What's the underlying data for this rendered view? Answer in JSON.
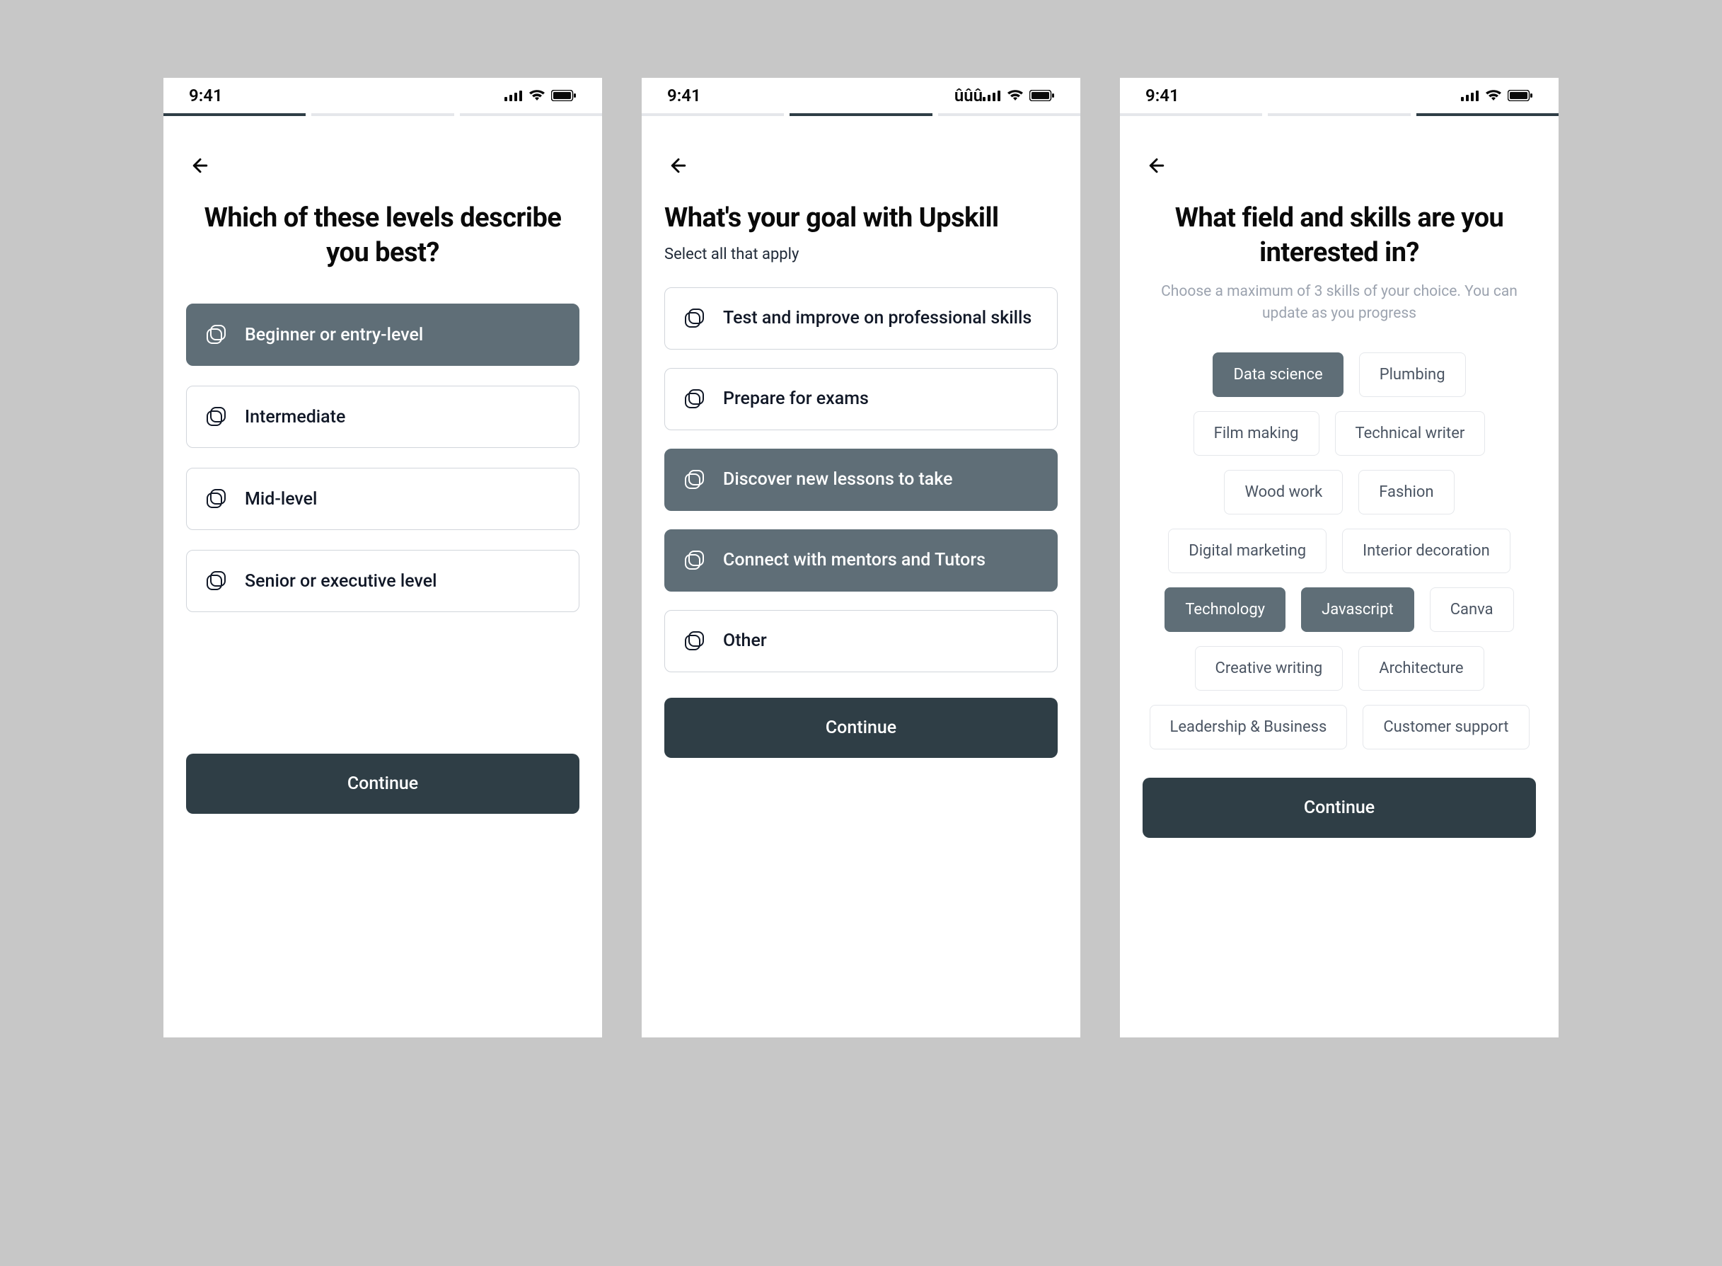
{
  "status": {
    "time": "9:41"
  },
  "colors": {
    "accent": "#5f6e77",
    "primary_button": "#2f3e46",
    "border": "#d1d5db",
    "bg": "#ffffff",
    "canvas": "#c7c7c7",
    "muted_text": "#9ca3af"
  },
  "screen1": {
    "progress_active": 0,
    "title": "Which of these levels describe you best?",
    "options": [
      {
        "label": "Beginner or entry-level",
        "selected": true
      },
      {
        "label": "Intermediate",
        "selected": false
      },
      {
        "label": "Mid-level",
        "selected": false
      },
      {
        "label": "Senior or executive level",
        "selected": false
      }
    ],
    "continue_label": "Continue"
  },
  "screen2": {
    "progress_active": 1,
    "title": "What's your goal with Upskill",
    "subtitle": "Select all that apply",
    "options": [
      {
        "label": "Test and improve on professional skills",
        "selected": false
      },
      {
        "label": "Prepare for exams",
        "selected": false
      },
      {
        "label": "Discover new lessons to take",
        "selected": true
      },
      {
        "label": "Connect with mentors and Tutors",
        "selected": true
      },
      {
        "label": "Other",
        "selected": false
      }
    ],
    "continue_label": "Continue"
  },
  "screen3": {
    "progress_active": 2,
    "title": "What field and skills are you interested in?",
    "subtitle": "Choose a maximum of 3 skills of your choice. You can update as you progress",
    "chips": [
      {
        "label": "Data science",
        "selected": true
      },
      {
        "label": "Plumbing",
        "selected": false
      },
      {
        "label": "Film making",
        "selected": false
      },
      {
        "label": "Technical writer",
        "selected": false
      },
      {
        "label": "Wood work",
        "selected": false
      },
      {
        "label": "Fashion",
        "selected": false
      },
      {
        "label": "Digital marketing",
        "selected": false
      },
      {
        "label": "Interior decoration",
        "selected": false
      },
      {
        "label": "Technology",
        "selected": true
      },
      {
        "label": "Javascript",
        "selected": true
      },
      {
        "label": "Canva",
        "selected": false
      },
      {
        "label": "Creative writing",
        "selected": false
      },
      {
        "label": "Architecture",
        "selected": false
      },
      {
        "label": "Leadership & Business",
        "selected": false
      },
      {
        "label": "Customer support",
        "selected": false
      }
    ],
    "continue_label": "Continue"
  }
}
